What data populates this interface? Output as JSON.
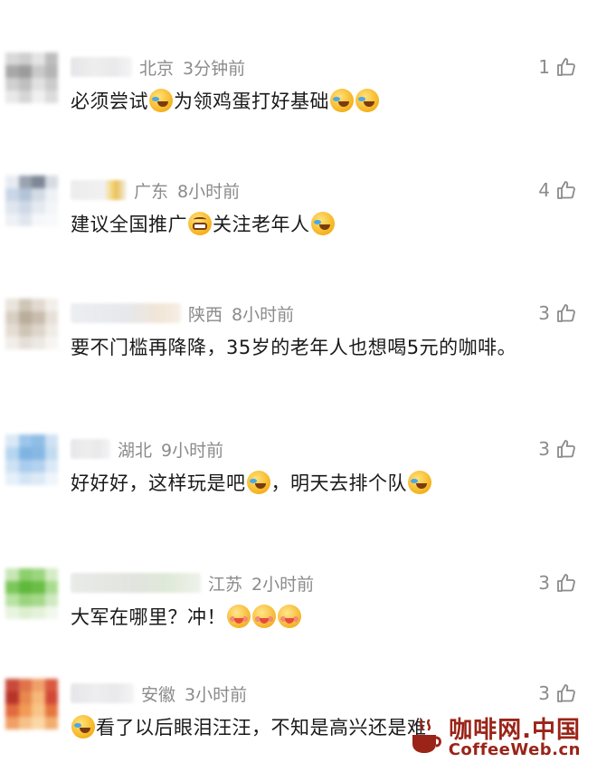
{
  "comments": [
    {
      "location": "北京",
      "time": "3分钟前",
      "likes": "1",
      "segments": [
        {
          "t": "必须尝试"
        },
        {
          "e": "laugh"
        },
        {
          "t": "为领鸡蛋打好基础"
        },
        {
          "e": "laugh"
        },
        {
          "e": "laugh"
        }
      ]
    },
    {
      "location": "广东",
      "time": "8小时前",
      "likes": "4",
      "segments": [
        {
          "t": "建议全国推广"
        },
        {
          "e": "grin"
        },
        {
          "t": "关注老年人"
        },
        {
          "e": "laugh"
        }
      ]
    },
    {
      "location": "陕西",
      "time": "8小时前",
      "likes": "3",
      "segments": [
        {
          "t": "要不门槛再降降，35岁的老年人也想喝5元的咖啡。"
        }
      ]
    },
    {
      "location": "湖北",
      "time": "9小时前",
      "likes": "3",
      "segments": [
        {
          "t": "好好好，这样玩是吧"
        },
        {
          "e": "laugh"
        },
        {
          "t": "，明天去排个队"
        },
        {
          "e": "laugh"
        }
      ]
    },
    {
      "location": "江苏",
      "time": "2小时前",
      "likes": "3",
      "segments": [
        {
          "t": "大军在哪里？冲！"
        },
        {
          "e": "blush"
        },
        {
          "e": "blush"
        },
        {
          "e": "blush"
        }
      ]
    },
    {
      "location": "安徽",
      "time": "3小时前",
      "likes": "3",
      "segments": [
        {
          "e": "laugh"
        },
        {
          "t": "看了以后眼泪汪汪，不知是高兴还是难"
        }
      ]
    }
  ],
  "watermark": {
    "cn": "咖啡网.中国",
    "en": "CoffeeWeb.cn",
    "color": "#9a2418"
  },
  "icons": {
    "like": "thumbs-up-icon",
    "emoji_laugh": "laugh-cry-emoji-icon",
    "emoji_grin": "grin-emoji-icon",
    "emoji_blush": "blush-emoji-icon"
  }
}
